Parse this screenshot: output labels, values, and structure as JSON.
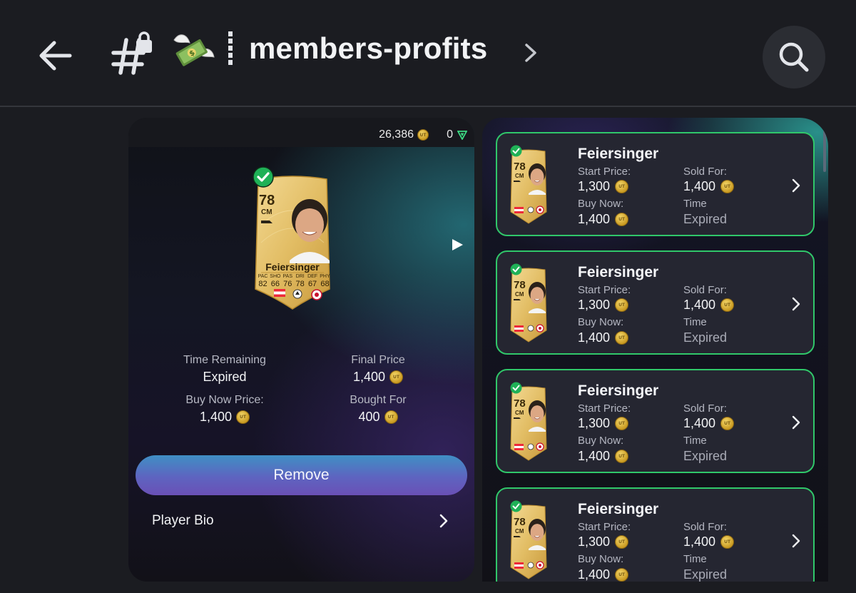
{
  "header": {
    "channel_name": "members-profits",
    "icons": [
      "back-arrow-icon",
      "locked-channel-hash-icon",
      "money-with-wings-icon",
      "chevron-right-icon",
      "search-icon"
    ]
  },
  "left_panel": {
    "coins": "26,386",
    "points": "0",
    "card": {
      "rating": "78",
      "position": "CM",
      "name": "Feiersinger",
      "stat_labels": [
        "PAC",
        "SHO",
        "PAS",
        "DRI",
        "DEF",
        "PHY"
      ],
      "stat_values": [
        "82",
        "66",
        "76",
        "78",
        "67",
        "68"
      ]
    },
    "time_remaining_label": "Time Remaining",
    "time_remaining_value": "Expired",
    "final_price_label": "Final Price",
    "final_price_value": "1,400",
    "buy_now_label": "Buy Now Price:",
    "buy_now_value": "1,400",
    "bought_for_label": "Bought For",
    "bought_for_value": "400",
    "remove_label": "Remove",
    "player_bio_label": "Player Bio"
  },
  "listings": [
    {
      "name": "Feiersinger",
      "rating": "78",
      "position": "CM",
      "start_price_label": "Start Price:",
      "start_price": "1,300",
      "sold_for_label": "Sold For:",
      "sold_for": "1,400",
      "buy_now_label": "Buy Now:",
      "buy_now": "1,400",
      "time_label": "Time",
      "time_value": "Expired"
    },
    {
      "name": "Feiersinger",
      "rating": "78",
      "position": "CM",
      "start_price_label": "Start Price:",
      "start_price": "1,300",
      "sold_for_label": "Sold For:",
      "sold_for": "1,400",
      "buy_now_label": "Buy Now:",
      "buy_now": "1,400",
      "time_label": "Time",
      "time_value": "Expired"
    },
    {
      "name": "Feiersinger",
      "rating": "78",
      "position": "CM",
      "start_price_label": "Start Price:",
      "start_price": "1,300",
      "sold_for_label": "Sold For:",
      "sold_for": "1,400",
      "buy_now_label": "Buy Now:",
      "buy_now": "1,400",
      "time_label": "Time",
      "time_value": "Expired"
    },
    {
      "name": "Feiersinger",
      "rating": "78",
      "position": "CM",
      "start_price_label": "Start Price:",
      "start_price": "1,300",
      "sold_for_label": "Sold For:",
      "sold_for": "1,400",
      "buy_now_label": "Buy Now:",
      "buy_now": "1,400",
      "time_label": "Time",
      "time_value": "Expired"
    }
  ],
  "colors": {
    "background": "#1b1c21",
    "listing_border": "#30c76a",
    "listing_bg": "#252631",
    "remove_gradient_top": "#3f8fc4",
    "remove_gradient_bottom": "#6a50b6",
    "gold_card": "#e2bd64"
  }
}
